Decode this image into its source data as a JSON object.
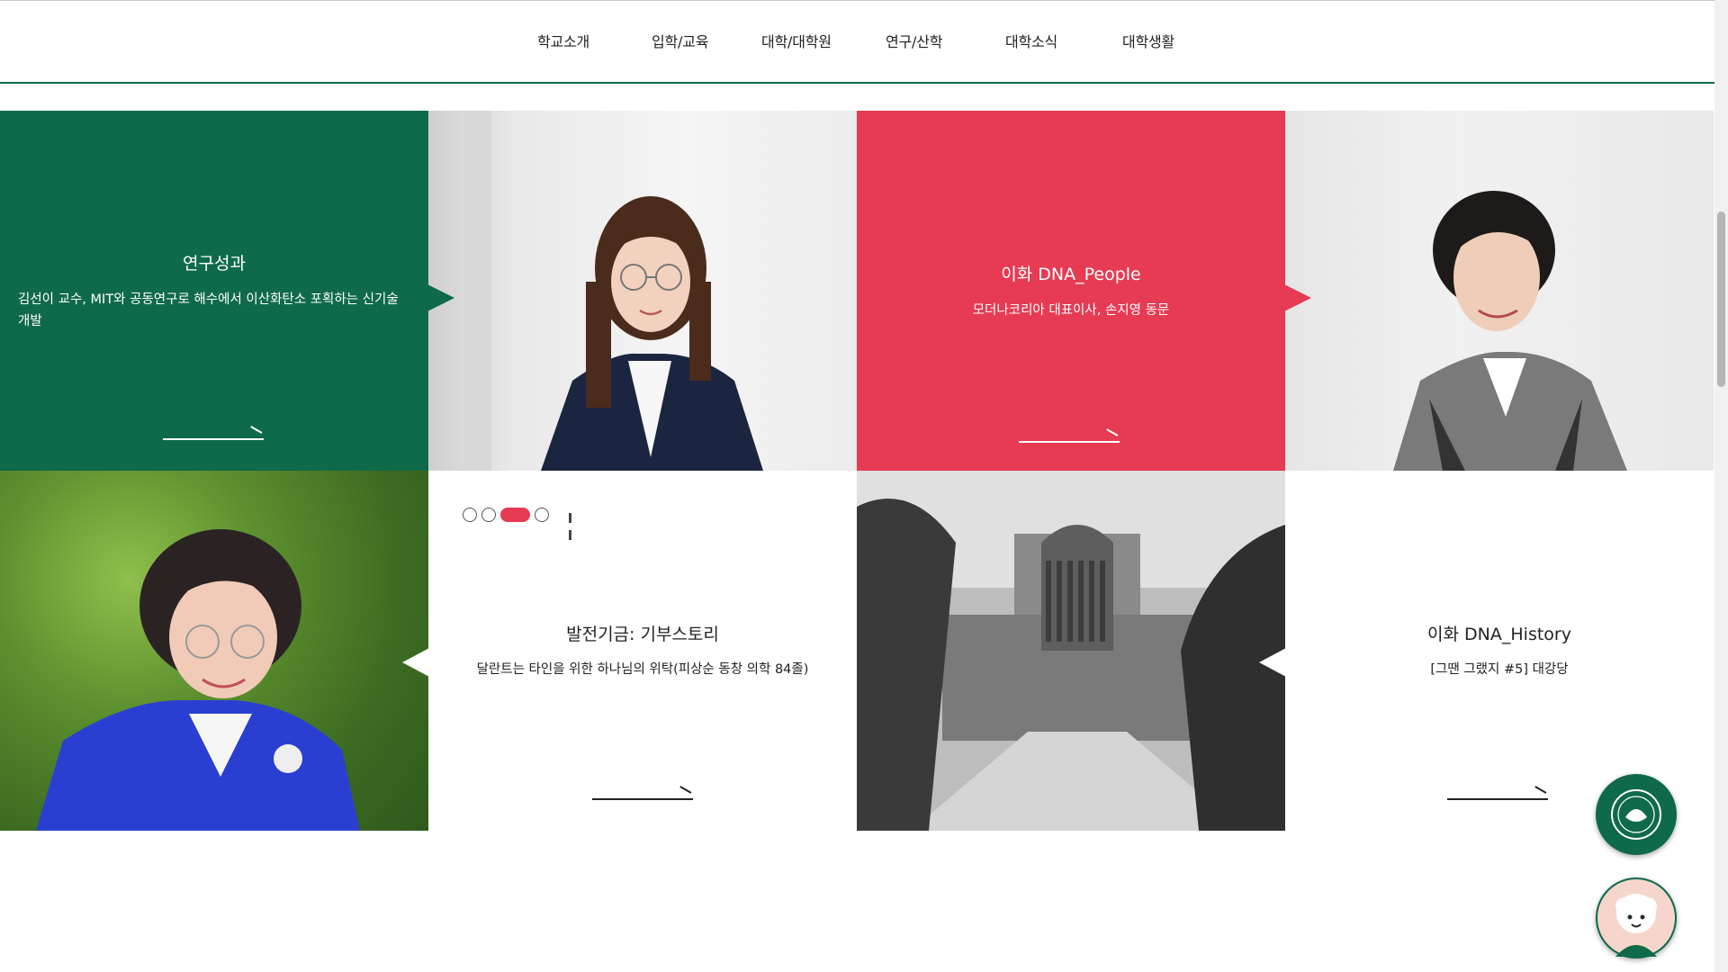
{
  "nav": {
    "items": [
      "학교소개",
      "입학/교육",
      "대학/대학원",
      "연구/산학",
      "대학소식",
      "대학생활"
    ]
  },
  "cards": {
    "research": {
      "title": "연구성과",
      "desc": "김선이 교수, MIT와 공동연구로 해수에서 이산화탄소 포획하는 신기술 개발"
    },
    "dna_people": {
      "title": "이화 DNA_People",
      "desc": "모더나코리아 대표이사, 손지영 동문"
    },
    "giving": {
      "title": "발전기금: 기부스토리",
      "desc": "달란트는 타인을 위한 하나님의 위탁(피상순 동창 의학 84졸)"
    },
    "dna_history": {
      "title": "이화 DNA_History",
      "desc": "[그땐 그랬지 #5] 대강당"
    }
  },
  "pager": {
    "count": 4,
    "active": 3
  },
  "icons": {
    "arrow": "arrow-right-icon",
    "pause": "pause-icon",
    "emblem": "ewha-emblem-icon",
    "chatbot": "chatbot-mascot-icon"
  },
  "colors": {
    "brand_green": "#0f6a4b",
    "accent_red": "#e63b53",
    "text_dark": "#222222"
  }
}
